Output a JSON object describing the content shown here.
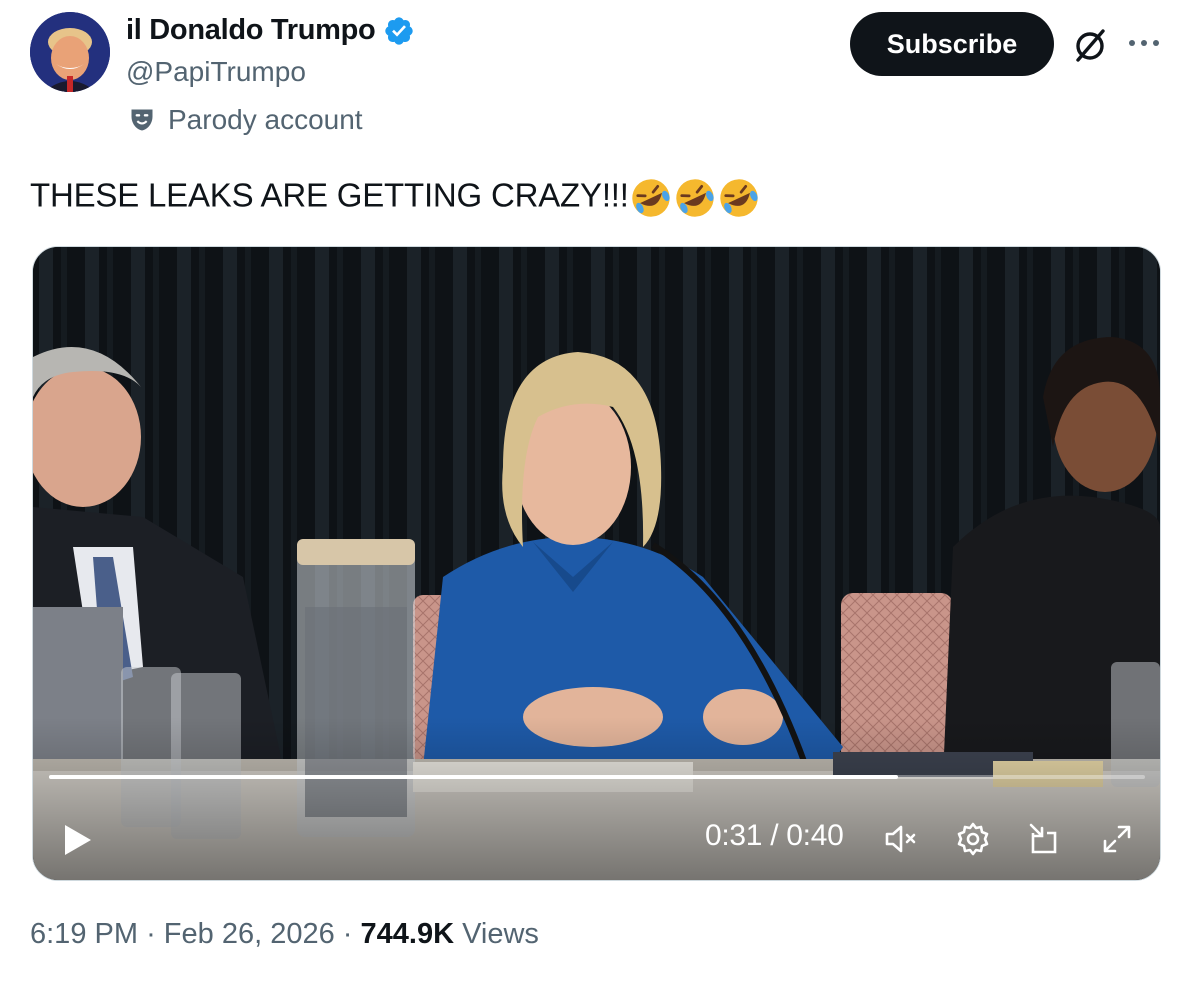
{
  "author": {
    "display_name": "il Donaldo Trumpo",
    "handle": "@PapiTrumpo",
    "label": "Parody account",
    "avatar_icon": "avatar-image",
    "verified_icon": "verified-badge-icon"
  },
  "actions": {
    "subscribe_label": "Subscribe",
    "grok_icon": "grok-icon",
    "more_icon": "more-icon"
  },
  "tweet": {
    "text": "THESE LEAKS ARE GETTING CRAZY!!!",
    "emojis": [
      "rolling-on-floor-laughing",
      "rolling-on-floor-laughing",
      "rolling-on-floor-laughing"
    ]
  },
  "video": {
    "current_time": "0:31",
    "duration": "0:40",
    "time_display": "0:31 / 0:40",
    "progress_fraction": 0.775
  },
  "meta": {
    "time": "6:19 PM",
    "date": "Feb 26, 2026",
    "views_count": "744.9K",
    "views_label": "Views",
    "sep": "·"
  },
  "colors": {
    "accent_verified": "#1d9bf0",
    "text_primary": "#0f1419",
    "text_secondary": "#536471",
    "button_dark": "#0f1419"
  }
}
